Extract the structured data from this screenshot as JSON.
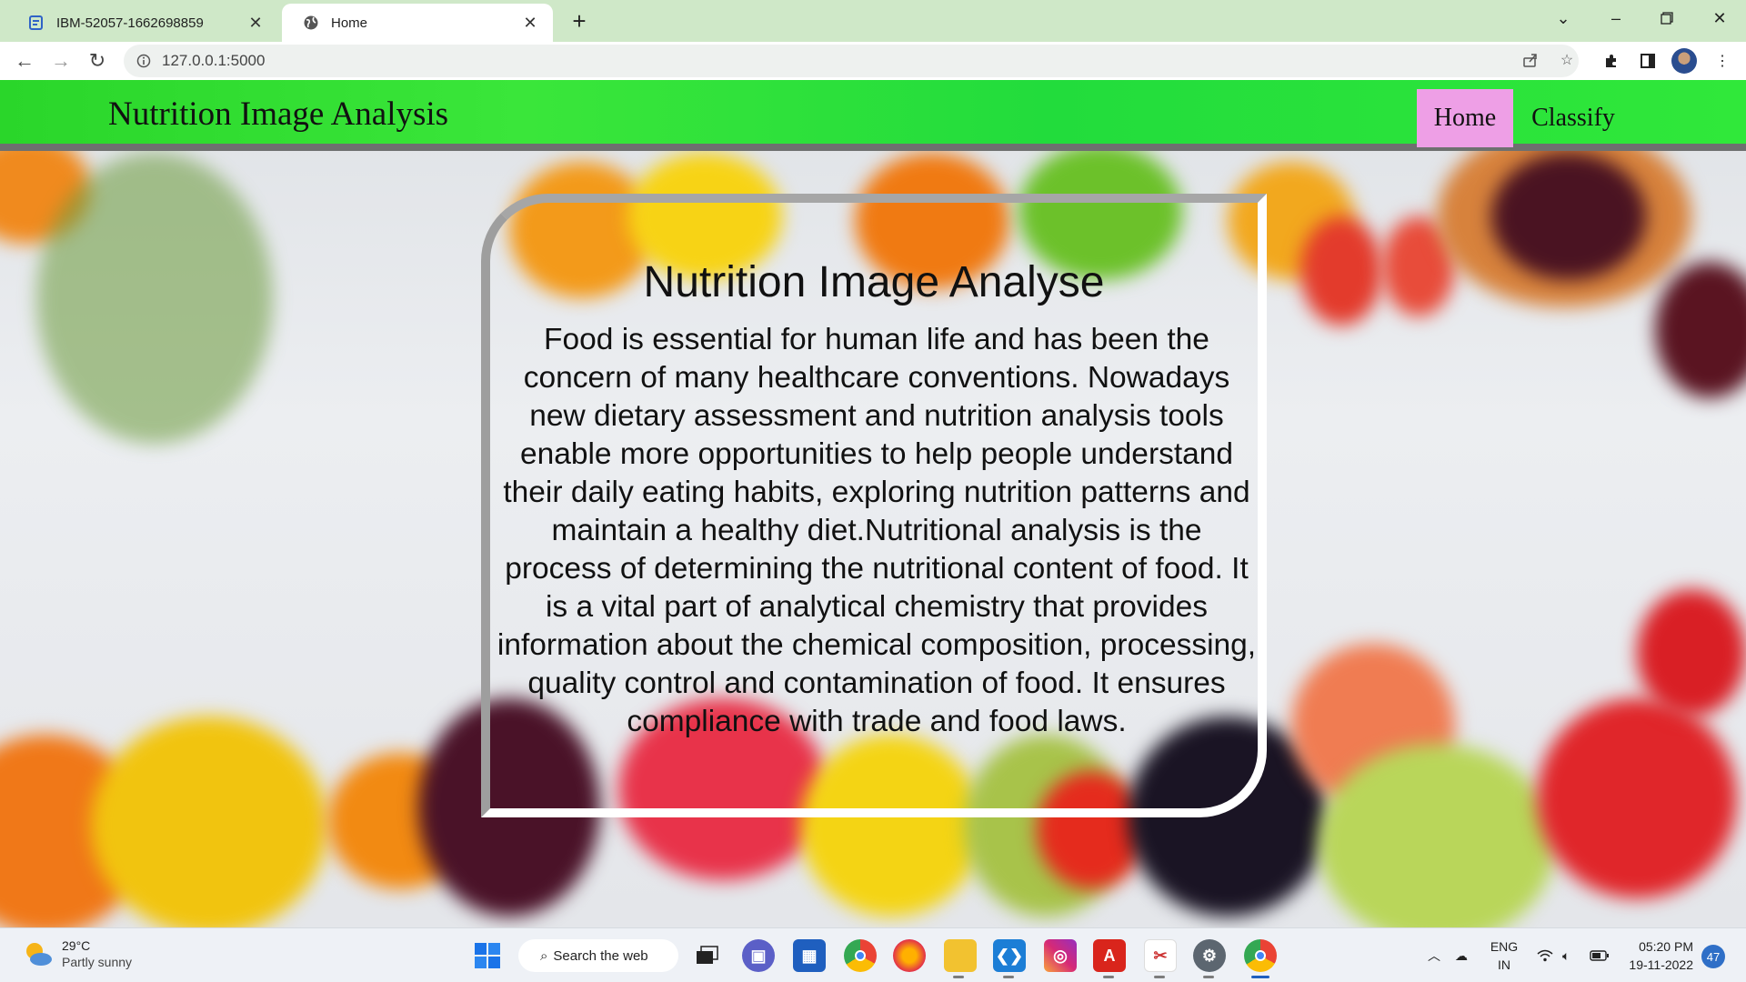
{
  "browser": {
    "tabs": [
      {
        "title": "IBM-52057-1662698859",
        "active": false
      },
      {
        "title": "Home",
        "active": true
      }
    ],
    "url": "127.0.0.1:5000"
  },
  "site": {
    "brand": "Nutrition Image Analysis",
    "nav": [
      {
        "label": "Home",
        "active": true
      },
      {
        "label": "Classify",
        "active": false
      }
    ],
    "card": {
      "title": "Nutrition Image Analyse",
      "body": "Food is essential for human life and has been the concern of many healthcare conventions. Nowadays new dietary assessment and nutrition analysis tools enable more opportunities to help people understand their daily eating habits, exploring nutrition patterns and maintain a healthy diet.Nutritional analysis is the process of determining the nutritional content of food. It is a vital part of analytical chemistry that provides information about the chemical composition, processing, quality control and contamination of food. It ensures compliance with trade and food laws."
    },
    "colors": {
      "navbar": "#2ad62a",
      "active_nav": "#ee9fe6"
    }
  },
  "taskbar": {
    "weather": {
      "temp": "29°C",
      "condition": "Partly sunny"
    },
    "search_label": "Search the web",
    "lang": {
      "line1": "ENG",
      "line2": "IN"
    },
    "clock": {
      "time": "05:20 PM",
      "date": "19-11-2022"
    },
    "notifications": "47"
  }
}
